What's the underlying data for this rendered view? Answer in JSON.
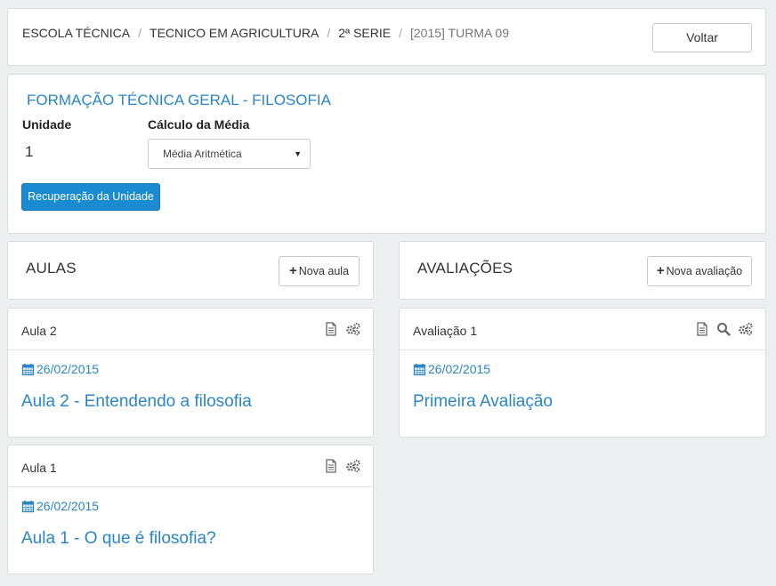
{
  "breadcrumb": [
    "ESCOLA TÉCNICA",
    "TECNICO EM AGRICULTURA",
    "2ª SERIE",
    "[2015] TURMA 09"
  ],
  "back_label": "Voltar",
  "info": {
    "subject": "FORMAÇÃO TÉCNICA GERAL - FILOSOFIA",
    "unit_label": "Unidade",
    "unit_value": "1",
    "calc_label": "Cálculo da Média",
    "calc_value": "Média Aritmética",
    "recovery_label": "Recuperação da Unidade"
  },
  "aulas": {
    "title": "AULAS",
    "new_label": "Nova aula",
    "items": [
      {
        "title": "Aula 2",
        "date": "26/02/2015",
        "link": "Aula 2 - Entendendo a filosofia"
      },
      {
        "title": "Aula 1",
        "date": "26/02/2015",
        "link": "Aula 1 - O que é filosofia?"
      }
    ]
  },
  "avaliacoes": {
    "title": "AVALIAÇÕES",
    "new_label": "Nova avaliação",
    "items": [
      {
        "title": "Avaliação 1",
        "date": "26/02/2015",
        "link": "Primeira Avaliação"
      }
    ]
  },
  "icons": {
    "document": "document-icon",
    "settings": "gears-icon",
    "search": "search-icon",
    "calendar": "calendar-icon",
    "plus": "plus-icon",
    "caret": "caret-down-icon"
  },
  "colors": {
    "link": "#2a86c6",
    "primary_button": "#1a8bd0",
    "background": "#eceeef"
  }
}
